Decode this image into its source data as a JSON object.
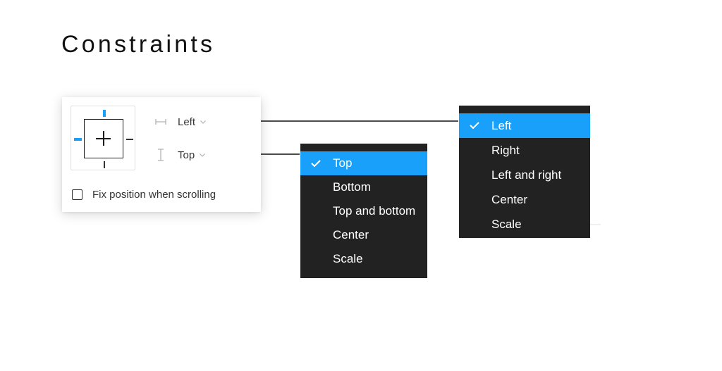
{
  "page": {
    "title": "Constraints"
  },
  "panel": {
    "horizontal": {
      "label": "Left",
      "icon": "horizontal-constraint-icon"
    },
    "vertical": {
      "label": "Top",
      "icon": "vertical-constraint-icon"
    },
    "fix_position": {
      "label": "Fix position when scrolling",
      "checked": false
    }
  },
  "vertical_menu": {
    "items": [
      {
        "label": "Top",
        "selected": true
      },
      {
        "label": "Bottom",
        "selected": false
      },
      {
        "label": "Top and bottom",
        "selected": false
      },
      {
        "label": "Center",
        "selected": false
      },
      {
        "label": "Scale",
        "selected": false
      }
    ]
  },
  "horizontal_menu": {
    "items": [
      {
        "label": "Left",
        "selected": true
      },
      {
        "label": "Right",
        "selected": false
      },
      {
        "label": "Left and right",
        "selected": false
      },
      {
        "label": "Center",
        "selected": false
      },
      {
        "label": "Scale",
        "selected": false
      }
    ]
  },
  "colors": {
    "accent": "#18a0fb",
    "menu_bg": "#222222",
    "text": "#333333"
  }
}
